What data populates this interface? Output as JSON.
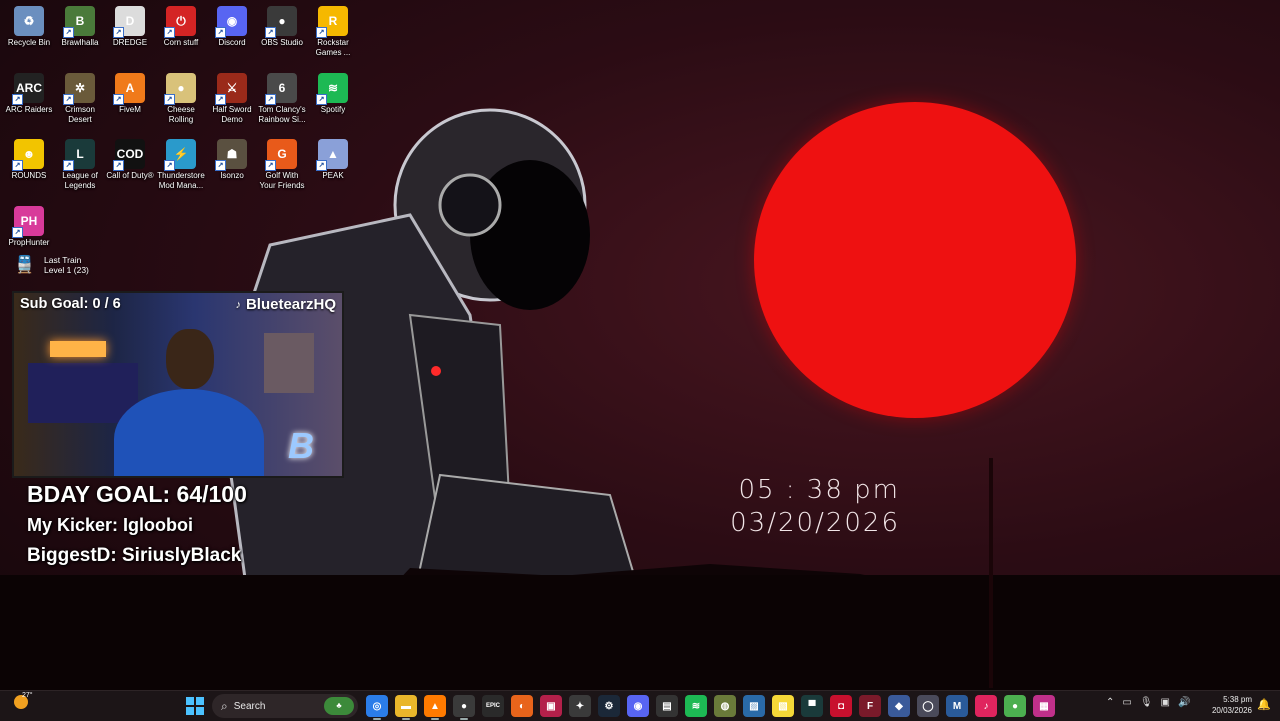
{
  "desktop_icons": [
    {
      "label": "Recycle Bin",
      "icon": "recycle-bin-icon",
      "color": "#6b8fbf",
      "glyph": "♻"
    },
    {
      "label": "Brawlhalla",
      "icon": "brawlhalla-icon",
      "color": "#4a7a3a",
      "glyph": "B"
    },
    {
      "label": "DREDGE",
      "icon": "dredge-icon",
      "color": "#dcdcdc",
      "glyph": "D"
    },
    {
      "label": "Corn stuff",
      "icon": "corn-stuff-icon",
      "color": "#d42424",
      "glyph": "⏻"
    },
    {
      "label": "Discord",
      "icon": "discord-icon",
      "color": "#5865f2",
      "glyph": "◉"
    },
    {
      "label": "OBS Studio",
      "icon": "obs-studio-icon",
      "color": "#3a3a3a",
      "glyph": "●"
    },
    {
      "label": "Rockstar Games ...",
      "icon": "rockstar-games-icon",
      "color": "#f6b800",
      "glyph": "R"
    },
    {
      "label": "ARC Raiders",
      "icon": "arc-raiders-icon",
      "color": "#222222",
      "glyph": "ARC"
    },
    {
      "label": "Crimson Desert",
      "icon": "crimson-desert-icon",
      "color": "#6a5a3a",
      "glyph": "✲"
    },
    {
      "label": "FiveM",
      "icon": "fivem-icon",
      "color": "#f07a1a",
      "glyph": "A"
    },
    {
      "label": "Cheese Rolling",
      "icon": "cheese-rolling-icon",
      "color": "#d9c27a",
      "glyph": "●"
    },
    {
      "label": "Half Sword Demo",
      "icon": "half-sword-icon",
      "color": "#9a2a1a",
      "glyph": "⚔"
    },
    {
      "label": "Tom Clancy's Rainbow Si...",
      "icon": "rainbow-six-icon",
      "color": "#4a4a4a",
      "glyph": "6"
    },
    {
      "label": "Spotify",
      "icon": "spotify-icon",
      "color": "#1db954",
      "glyph": "≋"
    },
    {
      "label": "ROUNDS",
      "icon": "rounds-icon",
      "color": "#f2c400",
      "glyph": "☻"
    },
    {
      "label": "League of Legends",
      "icon": "league-icon",
      "color": "#1a3a3a",
      "glyph": "L"
    },
    {
      "label": "Call of Duty®",
      "icon": "call-of-duty-icon",
      "color": "#111111",
      "glyph": "COD"
    },
    {
      "label": "Thunderstore Mod Mana...",
      "icon": "thunderstore-icon",
      "color": "#2a9acb",
      "glyph": "⚡"
    },
    {
      "label": "Isonzo",
      "icon": "isonzo-icon",
      "color": "#5a5040",
      "glyph": "☗"
    },
    {
      "label": "Golf With Your Friends",
      "icon": "golf-icon",
      "color": "#e85a1a",
      "glyph": "G"
    },
    {
      "label": "PEAK",
      "icon": "peak-icon",
      "color": "#8aa0d8",
      "glyph": "▲"
    },
    {
      "label": "PropHunter",
      "icon": "prophunter-icon",
      "color": "#d83a9a",
      "glyph": "PH"
    }
  ],
  "last_train": {
    "title": "Last Train",
    "subtitle": "Level 1  (23)"
  },
  "stream": {
    "sub_goal": "Sub Goal:  0 / 6",
    "username": "BluetearzHQ",
    "bday_goal": "BDAY GOAL: 64/100",
    "kicker": "My Kicker: Iglooboi",
    "biggest": "BiggestD: SiriuslyBlack"
  },
  "wallpaper_clock": {
    "time": "05 : 38  pm",
    "date": "03/20/2026"
  },
  "taskbar": {
    "weather_temp": "27°",
    "search_placeholder": "Search",
    "apps": [
      {
        "name": "chrome",
        "color": "#2b7de9",
        "glyph": "◎"
      },
      {
        "name": "file-explorer",
        "color": "#e9b62b",
        "glyph": "▬"
      },
      {
        "name": "vlc",
        "color": "#ff7a00",
        "glyph": "▲"
      },
      {
        "name": "obs",
        "color": "#3a3a3a",
        "glyph": "●"
      },
      {
        "name": "epic-games",
        "color": "#2a2a2a",
        "glyph": "EPIC"
      },
      {
        "name": "firefox",
        "color": "#e8641b",
        "glyph": "◐"
      },
      {
        "name": "app-red",
        "color": "#b3204a",
        "glyph": "▣"
      },
      {
        "name": "app-nvidia",
        "color": "#3a3a3a",
        "glyph": "✦"
      },
      {
        "name": "steam",
        "color": "#1b2838",
        "glyph": "⚙"
      },
      {
        "name": "discord",
        "color": "#5865f2",
        "glyph": "◉"
      },
      {
        "name": "app-capture",
        "color": "#333333",
        "glyph": "▤"
      },
      {
        "name": "spotify",
        "color": "#1db954",
        "glyph": "≋"
      },
      {
        "name": "app-round",
        "color": "#6a7a3a",
        "glyph": "◍"
      },
      {
        "name": "photos",
        "color": "#2a6aa8",
        "glyph": "▨"
      },
      {
        "name": "sticky-notes",
        "color": "#f6d838",
        "glyph": "▧"
      },
      {
        "name": "app-dark",
        "color": "#1a3a3a",
        "glyph": "▀"
      },
      {
        "name": "app-red2",
        "color": "#c8102e",
        "glyph": "◘"
      },
      {
        "name": "app-f",
        "color": "#7a1a2a",
        "glyph": "F"
      },
      {
        "name": "app-diamond",
        "color": "#3a5a9a",
        "glyph": "◆"
      },
      {
        "name": "app-gray",
        "color": "#4a4a5a",
        "glyph": "◯"
      },
      {
        "name": "medal",
        "color": "#2a5a9a",
        "glyph": "M"
      },
      {
        "name": "tiktok",
        "color": "#e0245e",
        "glyph": "♪"
      },
      {
        "name": "app-green",
        "color": "#4caf50",
        "glyph": "●"
      },
      {
        "name": "app-pink",
        "color": "#c0308a",
        "glyph": "▦"
      }
    ],
    "clock_time": "5:38 pm",
    "clock_date": "20/03/2026"
  }
}
